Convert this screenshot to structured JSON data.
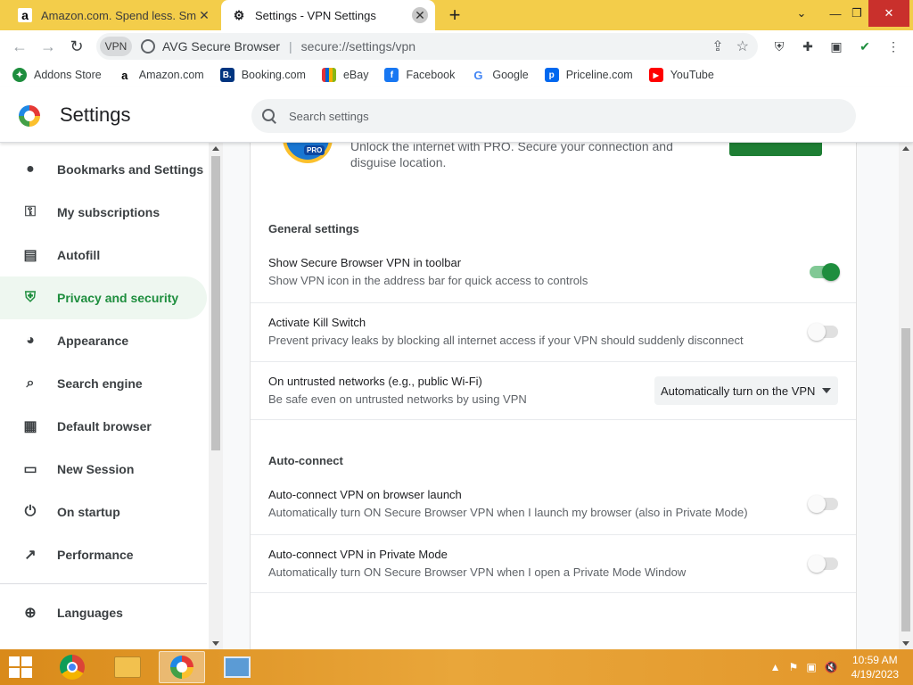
{
  "browser": {
    "tabs": [
      {
        "title": "Amazon.com. Spend less. Smile m",
        "favicon": "amazon-icon",
        "active": false
      },
      {
        "title": "Settings - VPN Settings",
        "favicon": "gear-icon",
        "active": true
      }
    ],
    "omnibox": {
      "vpn_label": "VPN",
      "site_label": "AVG Secure Browser",
      "url": "secure://settings/vpn"
    },
    "bookmarks": [
      {
        "label": "Addons Store",
        "icon": "addons-icon",
        "color": "#1e8e3e"
      },
      {
        "label": "Amazon.com",
        "icon": "amazon-icon",
        "color": "#000000"
      },
      {
        "label": "Booking.com",
        "icon": "booking-icon",
        "color": "#003580"
      },
      {
        "label": "eBay",
        "icon": "ebay-icon",
        "color": "#e53238"
      },
      {
        "label": "Facebook",
        "icon": "facebook-icon",
        "color": "#1877f2"
      },
      {
        "label": "Google",
        "icon": "google-icon",
        "color": "#4285f4"
      },
      {
        "label": "Priceline.com",
        "icon": "priceline-icon",
        "color": "#0068ef"
      },
      {
        "label": "YouTube",
        "icon": "youtube-icon",
        "color": "#ff0000"
      }
    ]
  },
  "settings": {
    "title": "Settings",
    "search_placeholder": "Search settings",
    "accent": "#1e8e3e",
    "sidebar": [
      {
        "label": "Bookmarks and Settings",
        "icon": "person-icon"
      },
      {
        "label": "My subscriptions",
        "icon": "key-icon"
      },
      {
        "label": "Autofill",
        "icon": "clipboard-icon"
      },
      {
        "label": "Privacy and security",
        "icon": "shield-icon",
        "active": true
      },
      {
        "label": "Appearance",
        "icon": "palette-icon"
      },
      {
        "label": "Search engine",
        "icon": "search-icon"
      },
      {
        "label": "Default browser",
        "icon": "browser-icon"
      },
      {
        "label": "New Session",
        "icon": "window-icon"
      },
      {
        "label": "On startup",
        "icon": "power-icon"
      },
      {
        "label": "Performance",
        "icon": "trending-icon"
      },
      {
        "label": "Languages",
        "icon": "globe-icon"
      }
    ],
    "pro_promo": "Unlock the internet with PRO. Secure your connection and disguise location.",
    "general": {
      "heading": "General settings",
      "rows": [
        {
          "title": "Show Secure Browser VPN in toolbar",
          "subtitle": "Show VPN icon in the address bar for quick access to controls",
          "enabled": true
        },
        {
          "title": "Activate Kill Switch",
          "subtitle": "Prevent privacy leaks by blocking all internet access if your VPN should suddenly disconnect",
          "enabled": false
        },
        {
          "title": "On untrusted networks (e.g., public Wi-Fi)",
          "subtitle": "Be safe even on untrusted networks by using VPN",
          "select_value": "Automatically turn on the VPN"
        }
      ]
    },
    "autoconnect": {
      "heading": "Auto-connect",
      "rows": [
        {
          "title": "Auto-connect VPN on browser launch",
          "subtitle": "Automatically turn ON Secure Browser VPN when I launch my browser (also in Private Mode)",
          "enabled": false
        },
        {
          "title": "Auto-connect VPN in Private Mode",
          "subtitle": "Automatically turn ON Secure Browser VPN when I open a Private Mode Window",
          "enabled": false
        }
      ]
    }
  },
  "taskbar": {
    "time": "10:59 AM",
    "date": "4/19/2023"
  }
}
